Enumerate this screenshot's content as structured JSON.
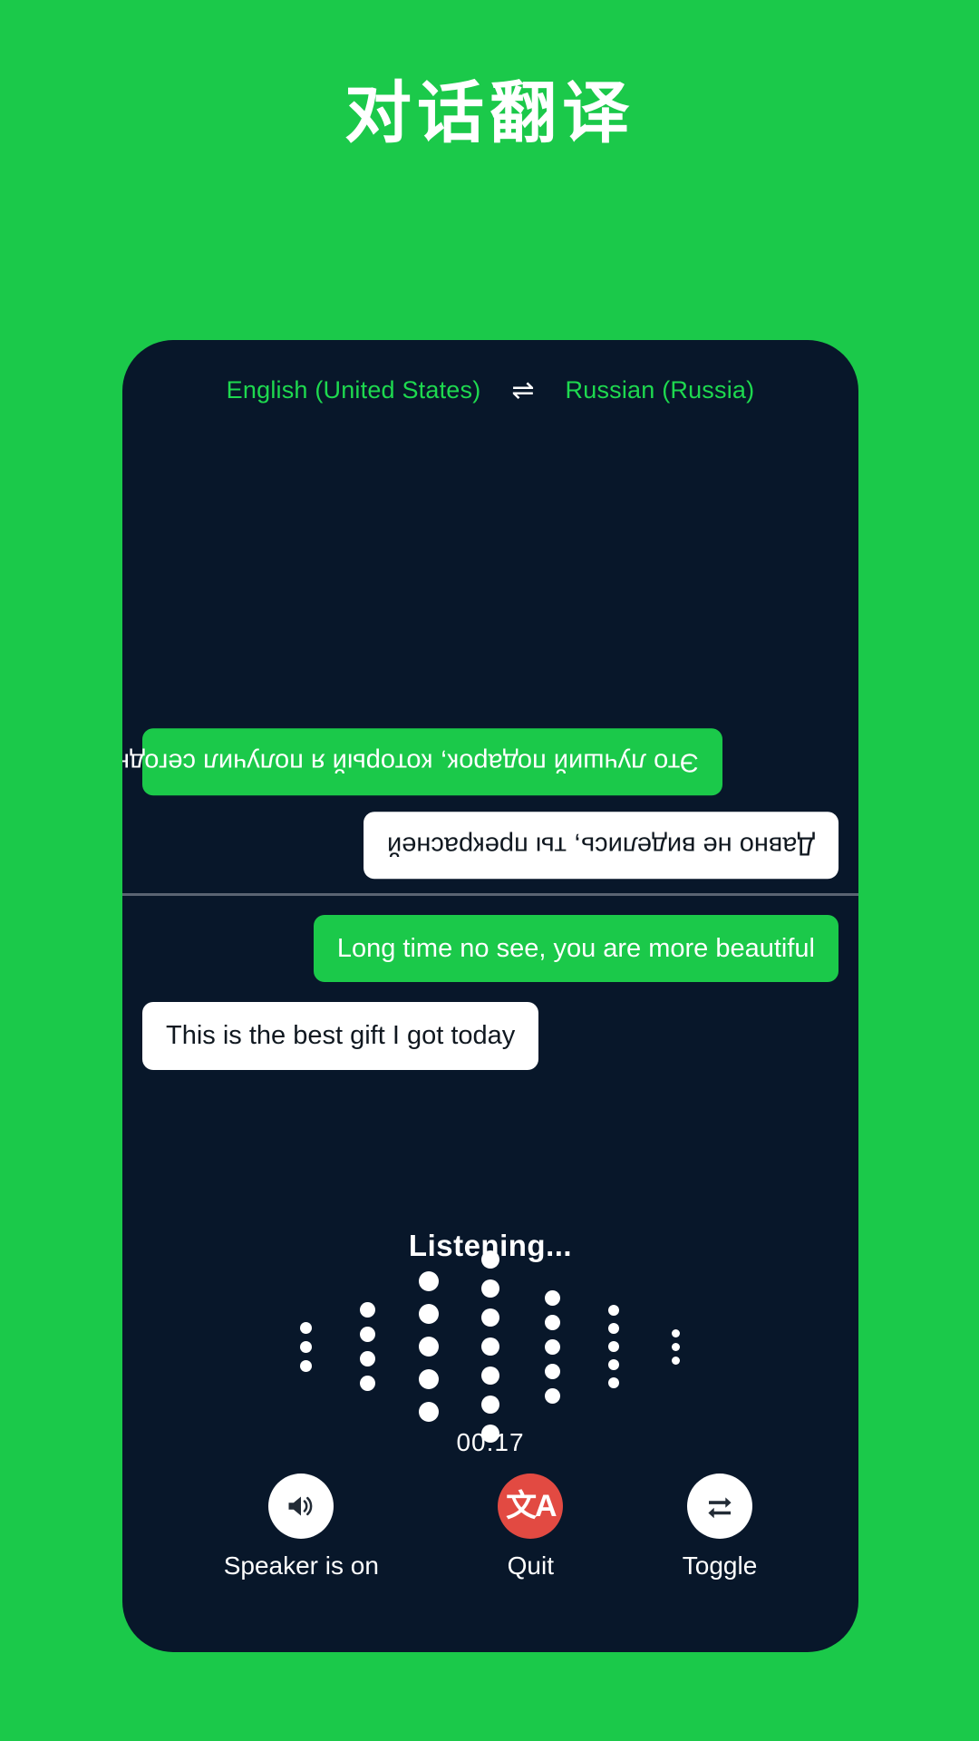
{
  "page": {
    "title": "对话翻译",
    "background_color": "#1bc94a",
    "card_color": "#08172a",
    "accent_green": "#1bc94a",
    "accent_red": "#e24a42"
  },
  "language_bar": {
    "source": "English (United States)",
    "swap_icon": "swap-horizontal-icon",
    "swap_glyph": "⇌",
    "target": "Russian (Russia)"
  },
  "conversation": {
    "remote_pane": {
      "rotated": true,
      "messages": [
        {
          "text": "Это лучший подарок, который я получил сегодня",
          "style": "green",
          "align": "left"
        },
        {
          "text": "Давно не виделись, ты прекрасней",
          "style": "white",
          "align": "right"
        }
      ]
    },
    "local_pane": {
      "rotated": false,
      "messages": [
        {
          "text": "Long time no see, you are more beautiful",
          "style": "green",
          "align": "right"
        },
        {
          "text": "This is the best gift I got today",
          "style": "white",
          "align": "left"
        }
      ]
    }
  },
  "status": {
    "listening_label": "Listening...",
    "timer": "00:17"
  },
  "waveform": {
    "type": "dot-bars",
    "columns": [
      {
        "count": 3,
        "size": 13
      },
      {
        "count": 4,
        "size": 17
      },
      {
        "count": 5,
        "size": 22
      },
      {
        "count": 7,
        "size": 20
      },
      {
        "count": 5,
        "size": 17
      },
      {
        "count": 5,
        "size": 12
      },
      {
        "count": 3,
        "size": 9
      }
    ],
    "dot_color": "#ffffff"
  },
  "controls": [
    {
      "id": "speaker",
      "label": "Speaker is on",
      "icon": "speaker-on-icon",
      "circle": "white"
    },
    {
      "id": "quit",
      "label": "Quit",
      "icon": "translate-icon",
      "glyph": "文A",
      "circle": "red"
    },
    {
      "id": "toggle",
      "label": "Toggle",
      "icon": "swap-repeat-icon",
      "circle": "white"
    }
  ]
}
